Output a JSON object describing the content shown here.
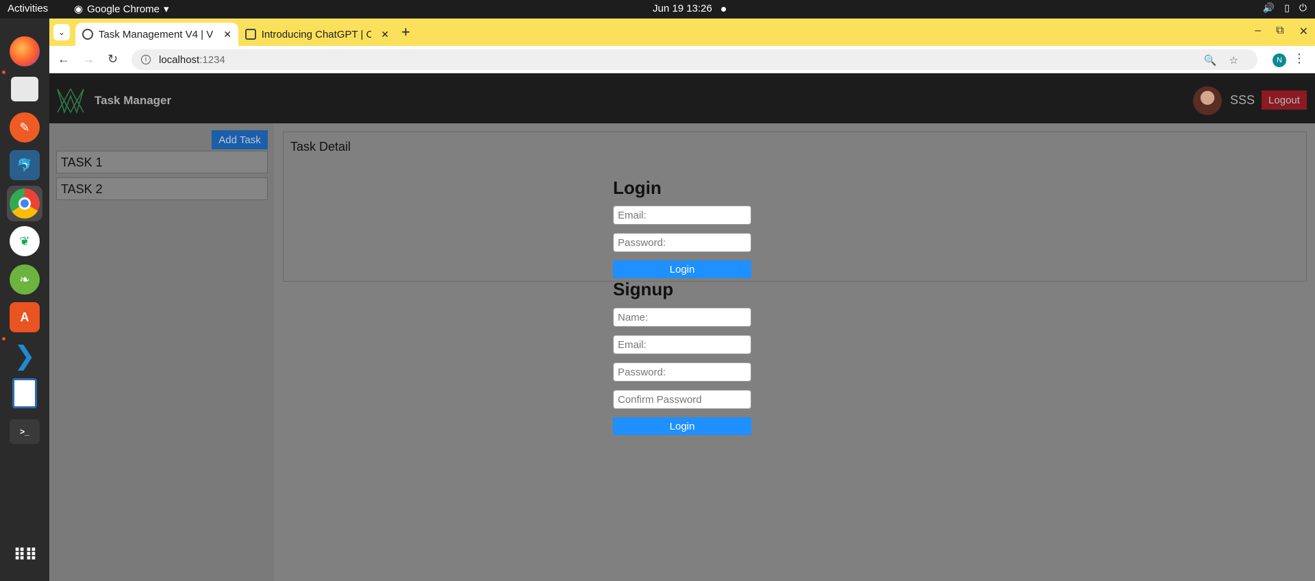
{
  "topbar": {
    "activities": "Activities",
    "app_name": "Google Chrome",
    "clock": "Jun 19  13:26"
  },
  "browser": {
    "tabs": [
      {
        "title": "Task Management V4 | V",
        "active": true
      },
      {
        "title": "Introducing ChatGPT | O",
        "active": false
      }
    ],
    "url_host": "localhost",
    "url_port": ":1234",
    "profile_initial": "N"
  },
  "app": {
    "title": "Task Manager",
    "username": "SSS",
    "logout_label": "Logout",
    "add_task_label": "Add Task",
    "tasks": [
      "TASK 1",
      "TASK 2"
    ],
    "detail_title": "Task Detail"
  },
  "login": {
    "heading": "Login",
    "email_placeholder": "Email:",
    "password_placeholder": "Password:",
    "button_label": "Login"
  },
  "signup": {
    "heading": "Signup",
    "name_placeholder": "Name:",
    "email_placeholder": "Email:",
    "password_placeholder": "Password:",
    "confirm_placeholder": "Confirm Password",
    "button_label": "Login"
  },
  "colors": {
    "chrome_tabstrip": "#fbe15b",
    "primary_button": "#1e90ff",
    "logout_button": "#8b1a23"
  },
  "dock_icons": [
    "firefox-icon",
    "files-icon",
    "postman-icon",
    "mysql-workbench-icon",
    "chrome-icon",
    "mongodb-compass-icon",
    "spring-tool-icon",
    "app-store-icon",
    "vscode-icon",
    "libreoffice-impress-icon",
    "terminal-icon",
    "app-grid-icon"
  ]
}
